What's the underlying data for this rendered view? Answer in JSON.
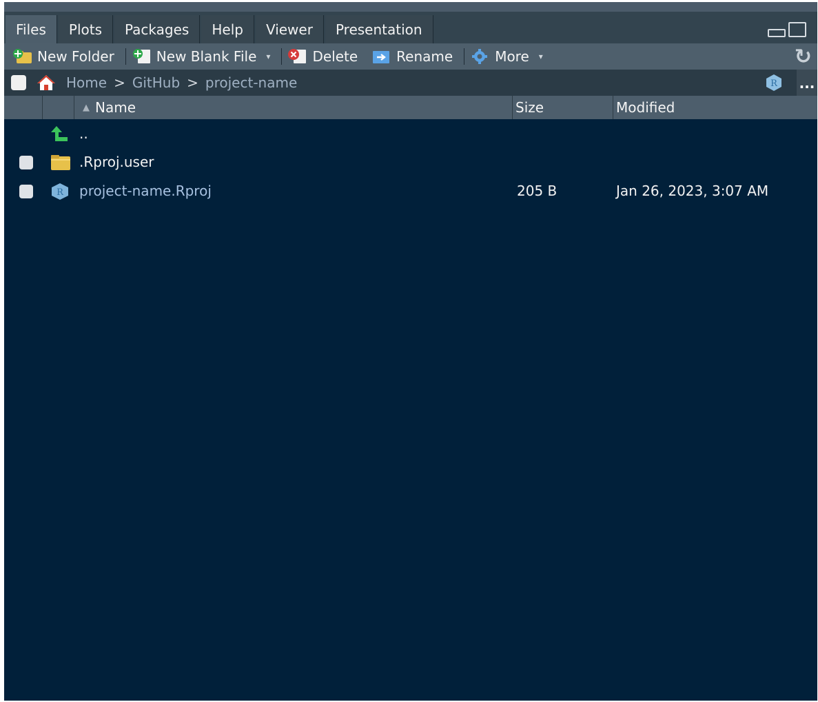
{
  "tabs": [
    {
      "label": "Files",
      "active": true
    },
    {
      "label": "Plots"
    },
    {
      "label": "Packages"
    },
    {
      "label": "Help"
    },
    {
      "label": "Viewer"
    },
    {
      "label": "Presentation"
    }
  ],
  "toolbar": {
    "new_folder": "New Folder",
    "new_blank_file": "New Blank File",
    "delete": "Delete",
    "rename": "Rename",
    "more": "More",
    "refresh_icon": "refresh-icon"
  },
  "path": {
    "home": "Home",
    "segments": [
      "GitHub",
      "project-name"
    ],
    "separator": ">",
    "overflow": "..."
  },
  "columns": {
    "name": "Name",
    "size": "Size",
    "modified": "Modified"
  },
  "files": [
    {
      "name": "..",
      "type": "parent",
      "icon": "up-arrow-icon"
    },
    {
      "name": ".Rproj.user",
      "type": "folder",
      "icon": "folder-icon",
      "size": "",
      "modified": ""
    },
    {
      "name": "project-name.Rproj",
      "type": "rproj",
      "icon": "rproj-icon",
      "size": "205 B",
      "modified": "Jan 26, 2023, 3:07 AM"
    }
  ],
  "colors": {
    "pane_bg": "#01203a",
    "toolbar_bg": "#4e5f6c",
    "path_link": "#9fb0c2",
    "file_link": "#a7c1e0",
    "up_arrow": "#3cc35b",
    "folder": "#e7c14a"
  }
}
